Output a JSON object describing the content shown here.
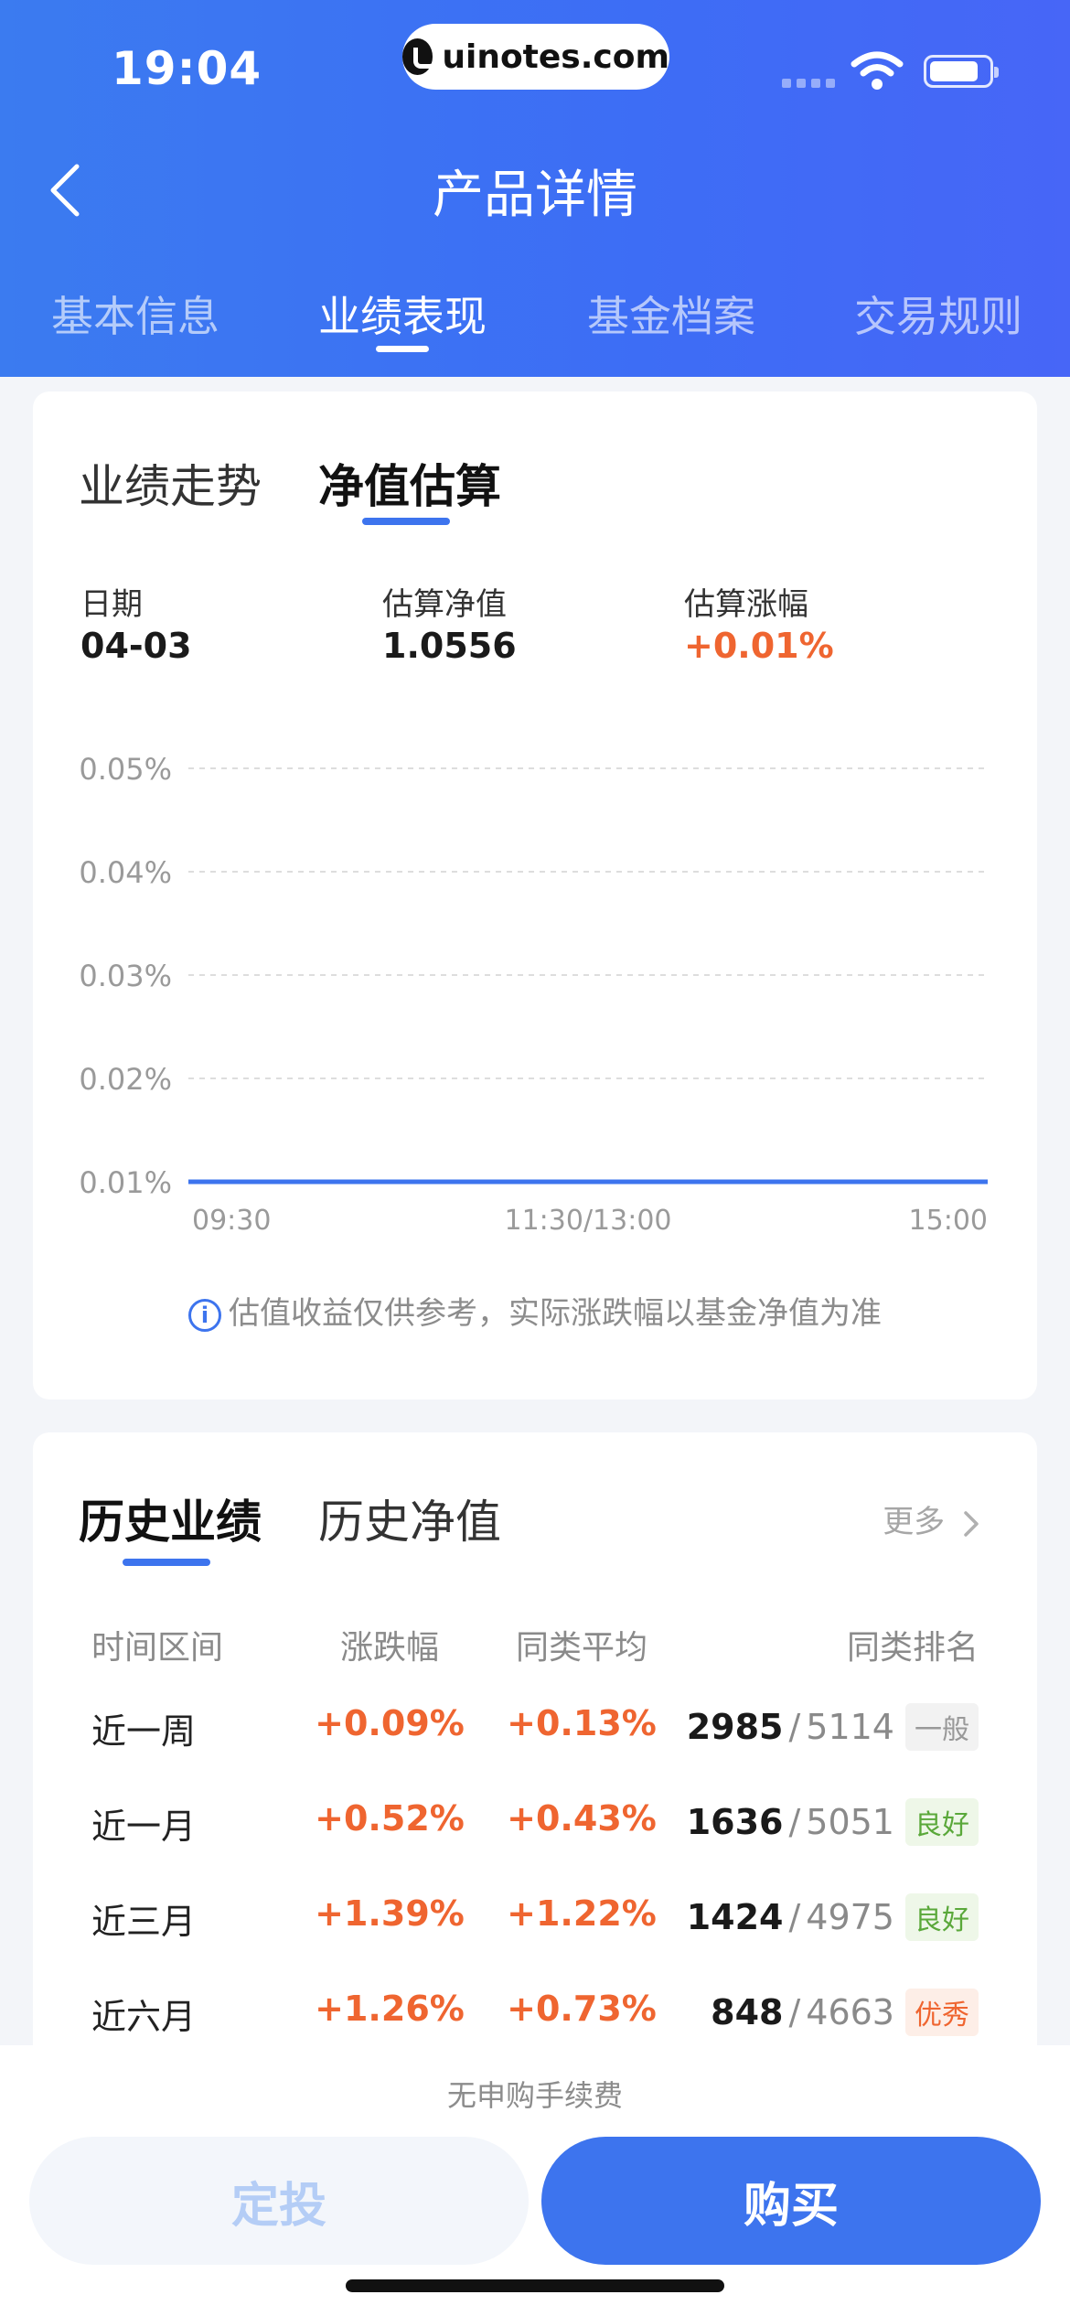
{
  "status_bar": {
    "time": "19:04",
    "brand": "uinotes.com"
  },
  "header": {
    "title": "产品详情",
    "tabs": [
      "基本信息",
      "业绩表现",
      "基金档案",
      "交易规则"
    ],
    "active_tab": "业绩表现"
  },
  "estimate_card": {
    "tabs": [
      "业绩走势",
      "净值估算"
    ],
    "active_tab": "净值估算",
    "stats": [
      {
        "label": "日期",
        "value": "04-03"
      },
      {
        "label": "估算净值",
        "value": "1.0556"
      },
      {
        "label": "估算涨幅",
        "value": "+0.01%"
      }
    ],
    "note": "估值收益仅供参考，实际涨跌幅以基金净值为准"
  },
  "chart_data": {
    "type": "line",
    "x_ticks": [
      "09:30",
      "11:30/13:00",
      "15:00"
    ],
    "y_ticks": [
      "0.05%",
      "0.04%",
      "0.03%",
      "0.02%",
      "0.01%"
    ],
    "ylim": [
      0.01,
      0.05
    ],
    "series": [
      {
        "x": [
          "09:30",
          "15:00"
        ],
        "values": [
          0.01,
          0.01
        ]
      }
    ],
    "colors": {
      "line": "#3d74ee",
      "grid": "#dddddd"
    },
    "grid": true
  },
  "history_card": {
    "tabs": [
      "历史业绩",
      "历史净值"
    ],
    "active_tab": "历史业绩",
    "more_label": "更多",
    "columns": [
      "时间区间",
      "涨跌幅",
      "同类平均",
      "同类排名"
    ],
    "rows": [
      {
        "period": "近一周",
        "change": "+0.09%",
        "avg": "+0.13%",
        "rank": "2985",
        "total": "5114",
        "level": "一般",
        "level_color": "#999999",
        "level_bg": "#f2f2f2"
      },
      {
        "period": "近一月",
        "change": "+0.52%",
        "avg": "+0.43%",
        "rank": "1636",
        "total": "5051",
        "level": "良好",
        "level_color": "#5aa83a",
        "level_bg": "#eef7e8"
      },
      {
        "period": "近三月",
        "change": "+1.39%",
        "avg": "+1.22%",
        "rank": "1424",
        "total": "4975",
        "level": "良好",
        "level_color": "#5aa83a",
        "level_bg": "#eef7e8"
      },
      {
        "period": "近六月",
        "change": "+1.26%",
        "avg": "+0.73%",
        "rank": "848",
        "total": "4663",
        "level": "优秀",
        "level_color": "#ef6530",
        "level_bg": "#fdeee7"
      }
    ],
    "separator": "/"
  },
  "bottom": {
    "fee_note": "无申购手续费",
    "plan_label": "定投",
    "buy_label": "购买"
  }
}
